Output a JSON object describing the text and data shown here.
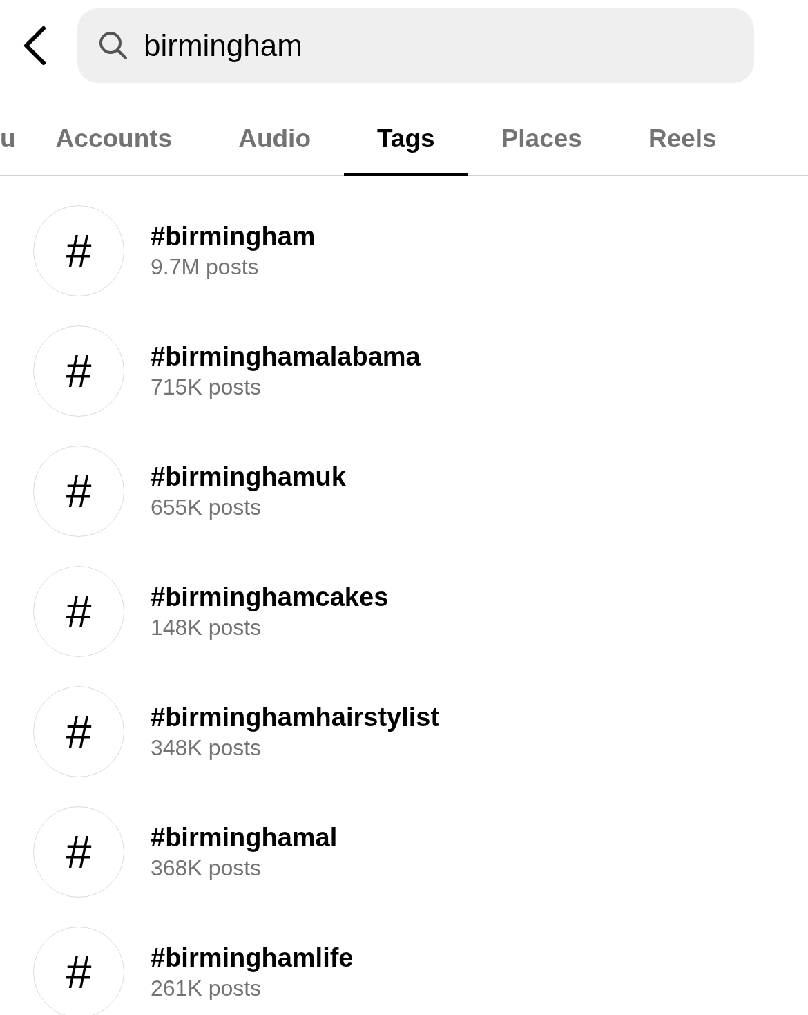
{
  "search": {
    "value": "birmingham"
  },
  "tabs": [
    {
      "label": "u",
      "selected": false
    },
    {
      "label": "Accounts",
      "selected": false
    },
    {
      "label": "Audio",
      "selected": false
    },
    {
      "label": "Tags",
      "selected": true
    },
    {
      "label": "Places",
      "selected": false
    },
    {
      "label": "Reels",
      "selected": false
    }
  ],
  "results": [
    {
      "icon": "#",
      "name": "#birmingham",
      "count": "9.7M posts"
    },
    {
      "icon": "#",
      "name": "#birminghamalabama",
      "count": "715K posts"
    },
    {
      "icon": "#",
      "name": "#birminghamuk",
      "count": "655K posts"
    },
    {
      "icon": "#",
      "name": "#birminghamcakes",
      "count": "148K posts"
    },
    {
      "icon": "#",
      "name": "#birminghamhairstylist",
      "count": "348K posts"
    },
    {
      "icon": "#",
      "name": "#birminghamal",
      "count": "368K posts"
    },
    {
      "icon": "#",
      "name": "#birminghamlife",
      "count": "261K posts"
    }
  ]
}
